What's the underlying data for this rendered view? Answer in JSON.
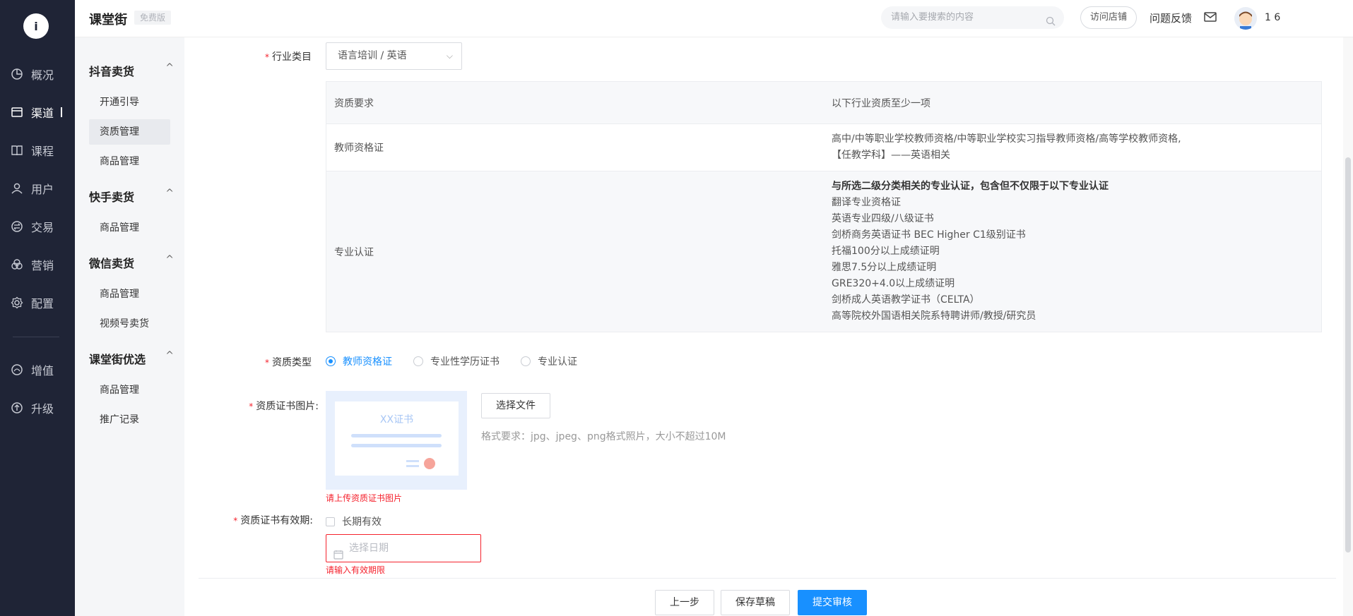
{
  "nav": {
    "logo_text": "i",
    "items": [
      {
        "label": "概况",
        "icon": "chart-pie-icon"
      },
      {
        "label": "渠道",
        "icon": "store-icon"
      },
      {
        "label": "课程",
        "icon": "book-icon"
      },
      {
        "label": "用户",
        "icon": "user-icon"
      },
      {
        "label": "交易",
        "icon": "exchange-icon"
      },
      {
        "label": "营销",
        "icon": "marketing-icon"
      },
      {
        "label": "配置",
        "icon": "gear-icon"
      },
      {
        "label": "增值",
        "icon": "value-added-icon"
      },
      {
        "label": "升级",
        "icon": "upgrade-icon"
      }
    ],
    "active_index": 1
  },
  "header": {
    "brand": "课堂街",
    "badge": "免费版",
    "search_placeholder": "请输入要搜索的内容",
    "visit_store": "访问店铺",
    "feedback": "问题反馈",
    "user_name": "1                6"
  },
  "submenu": {
    "groups": [
      {
        "title": "抖音卖货",
        "items": [
          "开通引导",
          "资质管理",
          "商品管理"
        ]
      },
      {
        "title": "快手卖货",
        "items": [
          "商品管理"
        ]
      },
      {
        "title": "微信卖货",
        "items": [
          "商品管理",
          "视频号卖货"
        ]
      },
      {
        "title": "课堂街优选",
        "items": [
          "商品管理",
          "推广记录"
        ]
      }
    ],
    "chevron": "^"
  },
  "form": {
    "industry_label": "行业类目",
    "industry_value": "语言培训 / 英语",
    "table": {
      "head": [
        "资质要求",
        "以下行业资质至少一项"
      ],
      "rows": [
        {
          "name": "教师资格证",
          "lines": [
            "高中/中等职业学校教师资格/中等职业学校实习指导教师资格/高等学校教师资格,",
            "【任教学科】——英语相关"
          ]
        },
        {
          "name": "专业认证",
          "lines": [
            "与所选二级分类相关的专业认证，包含但不仅限于以下专业认证",
            "翻译专业资格证",
            "英语专业四级/八级证书",
            "剑桥商务英语证书 BEC Higher C1级别证书",
            "托福100分以上成绩证明",
            "雅思7.5分以上成绩证明",
            "GRE320+4.0以上成绩证明",
            "剑桥成人英语教学证书（CELTA）",
            "高等院校外国语相关院系特聘讲师/教授/研究员"
          ]
        }
      ]
    },
    "type_label": "资质类型",
    "type_options": [
      "教师资格证",
      "专业性学历证书",
      "专业认证"
    ],
    "type_selected": 0,
    "cert_image_label": "资质证书图片:",
    "cert_preview_title": "XX证书",
    "choose_file": "选择文件",
    "format_hint": "格式要求：jpg、jpeg、png格式照片，大小不超过10M",
    "cert_image_error": "请上传资质证书图片",
    "validity_label": "资质证书有效期:",
    "long_term": "长期有效",
    "date_placeholder": "选择日期",
    "validity_error": "请输入有效期限",
    "required_mark": "*"
  },
  "footer": {
    "prev": "上一步",
    "save_draft": "保存草稿",
    "submit": "提交审核"
  },
  "colors": {
    "primary": "#1890ff",
    "error": "#f5222d",
    "sidebar": "#1f2436"
  }
}
